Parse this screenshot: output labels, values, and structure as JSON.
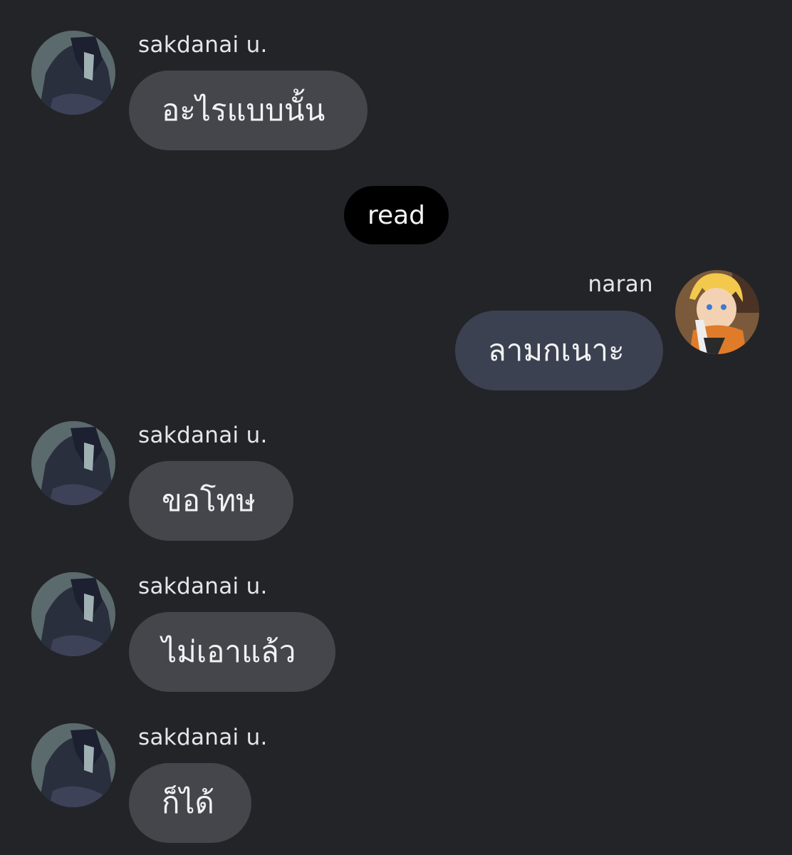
{
  "conversation": {
    "read_receipt": "read",
    "messages": [
      {
        "sender": "sakdanai u.",
        "text": "อะไรแบบนั้น",
        "direction": "incoming"
      },
      {
        "sender": "naran",
        "text": "ลามกเนาะ",
        "direction": "outgoing"
      },
      {
        "sender": "sakdanai u.",
        "text": "ขอโทษ",
        "direction": "incoming"
      },
      {
        "sender": "sakdanai u.",
        "text": "ไม่เอาแล้ว",
        "direction": "incoming"
      },
      {
        "sender": "sakdanai u.",
        "text": "ก็ได้",
        "direction": "incoming"
      }
    ]
  },
  "colors": {
    "background": "#232428",
    "incoming_bubble": "#45464c",
    "outgoing_bubble": "#3b4150",
    "read_pill": "#000000",
    "text": "#f2f2f4"
  },
  "icons": {
    "incoming_avatar": "dark-haired-character-avatar-icon",
    "outgoing_avatar": "blond-character-avatar-icon"
  }
}
